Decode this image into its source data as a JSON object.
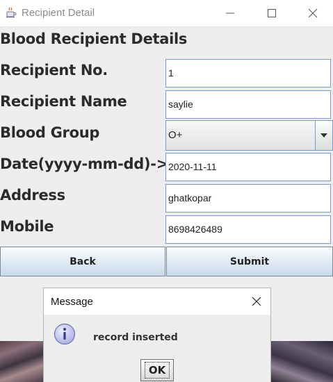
{
  "window": {
    "title": "Recipient Detail",
    "controls": {
      "minimize_icon": "minimize-icon",
      "maximize_icon": "maximize-icon",
      "close_icon": "close-icon"
    },
    "app_icon": "java-cup-icon"
  },
  "form": {
    "heading": "Blood Recipient Details",
    "fields": [
      {
        "label": "Recipient No.",
        "value": "1"
      },
      {
        "label": "Recipient Name",
        "value": "saylie"
      },
      {
        "label": "Blood Group",
        "value": "O+"
      },
      {
        "label": "Date(yyyy-mm-dd)->",
        "value": "2020-11-11"
      },
      {
        "label": "Address",
        "value": "ghatkopar"
      },
      {
        "label": "Mobile",
        "value": "8698426489"
      }
    ],
    "buttons": {
      "back": "Back",
      "submit": "Submit"
    }
  },
  "dialog": {
    "title": "Message",
    "icon": "info-icon",
    "message": "record inserted",
    "ok_label": "OK"
  },
  "colors": {
    "field_border": "#7a9cc8",
    "button_gradient_bottom": "#c9d9ea",
    "info_icon": "#b7b9e8"
  }
}
